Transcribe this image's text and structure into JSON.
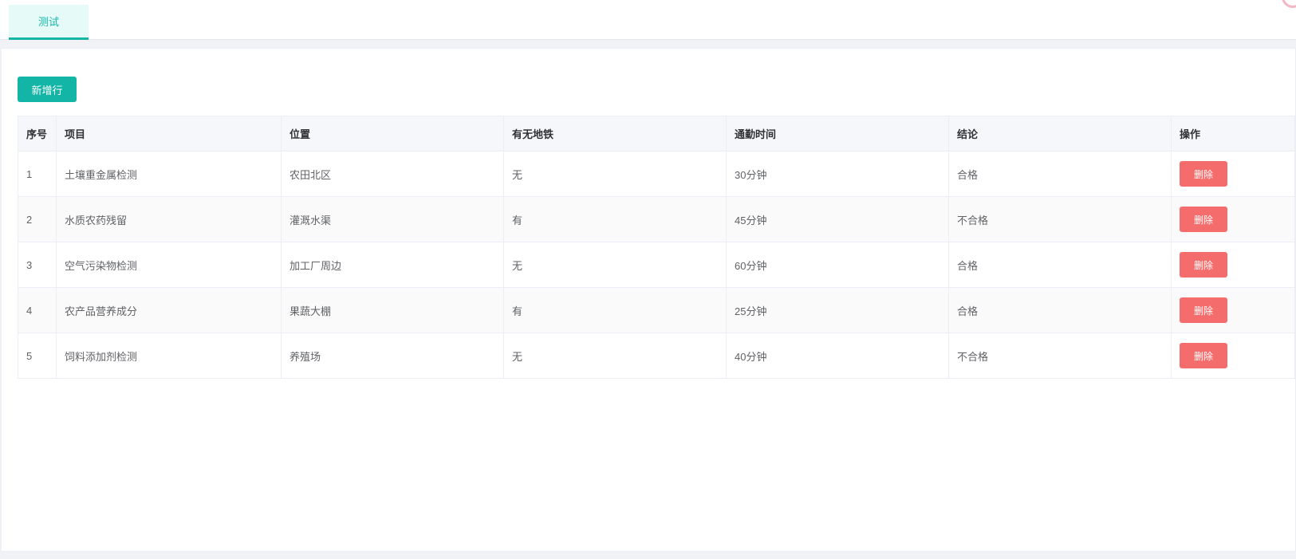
{
  "tabs": [
    {
      "label": "测试",
      "active": true
    }
  ],
  "toolbar": {
    "add_row_label": "新增行"
  },
  "table": {
    "columns": [
      "序号",
      "项目",
      "位置",
      "有无地铁",
      "通勤时间",
      "结论",
      "操作"
    ],
    "rows": [
      {
        "index": "1",
        "item": "土壤重金属检测",
        "location": "农田北区",
        "subway": "无",
        "commute": "30分钟",
        "conclusion": "合格",
        "action": "删除"
      },
      {
        "index": "2",
        "item": "水质农药残留",
        "location": "灌溉水渠",
        "subway": "有",
        "commute": "45分钟",
        "conclusion": "不合格",
        "action": "删除"
      },
      {
        "index": "3",
        "item": "空气污染物检测",
        "location": "加工厂周边",
        "subway": "无",
        "commute": "60分钟",
        "conclusion": "合格",
        "action": "删除"
      },
      {
        "index": "4",
        "item": "农产品营养成分",
        "location": "果蔬大棚",
        "subway": "有",
        "commute": "25分钟",
        "conclusion": "合格",
        "action": "删除"
      },
      {
        "index": "5",
        "item": "饲料添加剂检测",
        "location": "养殖场",
        "subway": "无",
        "commute": "40分钟",
        "conclusion": "不合格",
        "action": "删除"
      }
    ]
  },
  "colors": {
    "accent": "#13b5a6",
    "danger": "#f56c6c",
    "header_bg": "#f5f7fa"
  }
}
